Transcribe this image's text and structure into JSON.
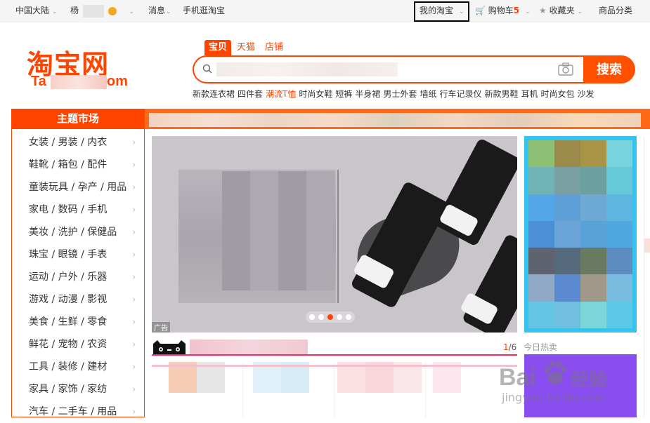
{
  "topbar": {
    "region": "中国大陆",
    "user_prefix": "杨",
    "messages": "消息",
    "mobile": "手机逛淘宝",
    "my_taobao": "我的淘宝",
    "cart": "购物车",
    "cart_count": "5",
    "favorites": "收藏夹",
    "categories": "商品分类"
  },
  "logo": {
    "title": "淘宝网",
    "sub_left": "Ta",
    "sub_right": "om"
  },
  "search": {
    "tabs": [
      "宝贝",
      "天猫",
      "店铺"
    ],
    "button": "搜索",
    "hotwords": [
      "新款连衣裙",
      "四件套",
      "潮流T恤",
      "时尚女鞋",
      "短裤",
      "半身裙",
      "男士外套",
      "墙纸",
      "行车记录仪",
      "新款男鞋",
      "耳机",
      "时尚女包",
      "沙发"
    ],
    "hotword_highlight_index": 2
  },
  "sidebar": {
    "title": "主题市场",
    "items": [
      "女装 / 男装 / 内衣",
      "鞋靴 / 箱包 / 配件",
      "童装玩具 / 孕产 / 用品",
      "家电 / 数码 / 手机",
      "美妆 / 洗护 / 保健品",
      "珠宝 / 眼镜 / 手表",
      "运动 / 户外 / 乐器",
      "游戏 / 动漫 / 影视",
      "美食 / 生鲜 / 零食",
      "鲜花 / 宠物 / 农资",
      "工具 / 装修 / 建材",
      "家具 / 家饰 / 家纺",
      "汽车 / 二手车 / 用品"
    ]
  },
  "banner": {
    "ad_label": "广告",
    "dot_count": 5,
    "active_dot": 2
  },
  "strip": {
    "page_current": "1",
    "page_total": "/6"
  },
  "today_hot": "今日热卖",
  "watermark": {
    "brand": "Bai",
    "brand2": "经验",
    "url": "jingyan.baidu.com"
  },
  "colors": {
    "accent": "#ff4400",
    "cart_accent": "#ff4400"
  }
}
